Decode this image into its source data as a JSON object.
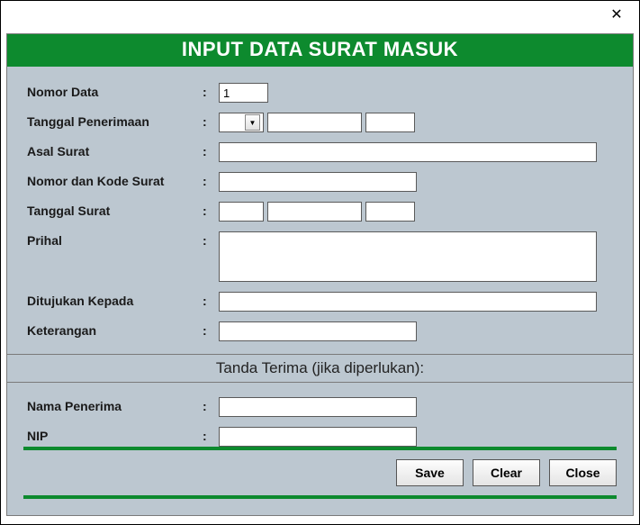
{
  "window": {
    "title": "INPUT DATA SURAT MASUK"
  },
  "labels": {
    "nomor_data": "Nomor Data",
    "tanggal_penerimaan": "Tanggal Penerimaan",
    "asal_surat": "Asal Surat",
    "nomor_kode": "Nomor dan Kode Surat",
    "tanggal_surat": "Tanggal Surat",
    "prihal": "Prihal",
    "ditujukan": "Ditujukan Kepada",
    "keterangan": "Keterangan",
    "section_receipt": "Tanda Terima (jika diperlukan):",
    "nama_penerima": "Nama Penerima",
    "nip": "NIP"
  },
  "values": {
    "nomor_data": "1",
    "tp_day": "",
    "tp_month": "",
    "tp_year": "",
    "asal_surat": "",
    "nomor_kode": "",
    "ts_day": "",
    "ts_month": "",
    "ts_year": "",
    "prihal": "",
    "ditujukan": "",
    "keterangan": "",
    "nama_penerima": "",
    "nip": ""
  },
  "buttons": {
    "save": "Save",
    "clear": "Clear",
    "close": "Close"
  },
  "colors": {
    "accent": "#0d8a2e",
    "panel": "#bcc7d0"
  }
}
